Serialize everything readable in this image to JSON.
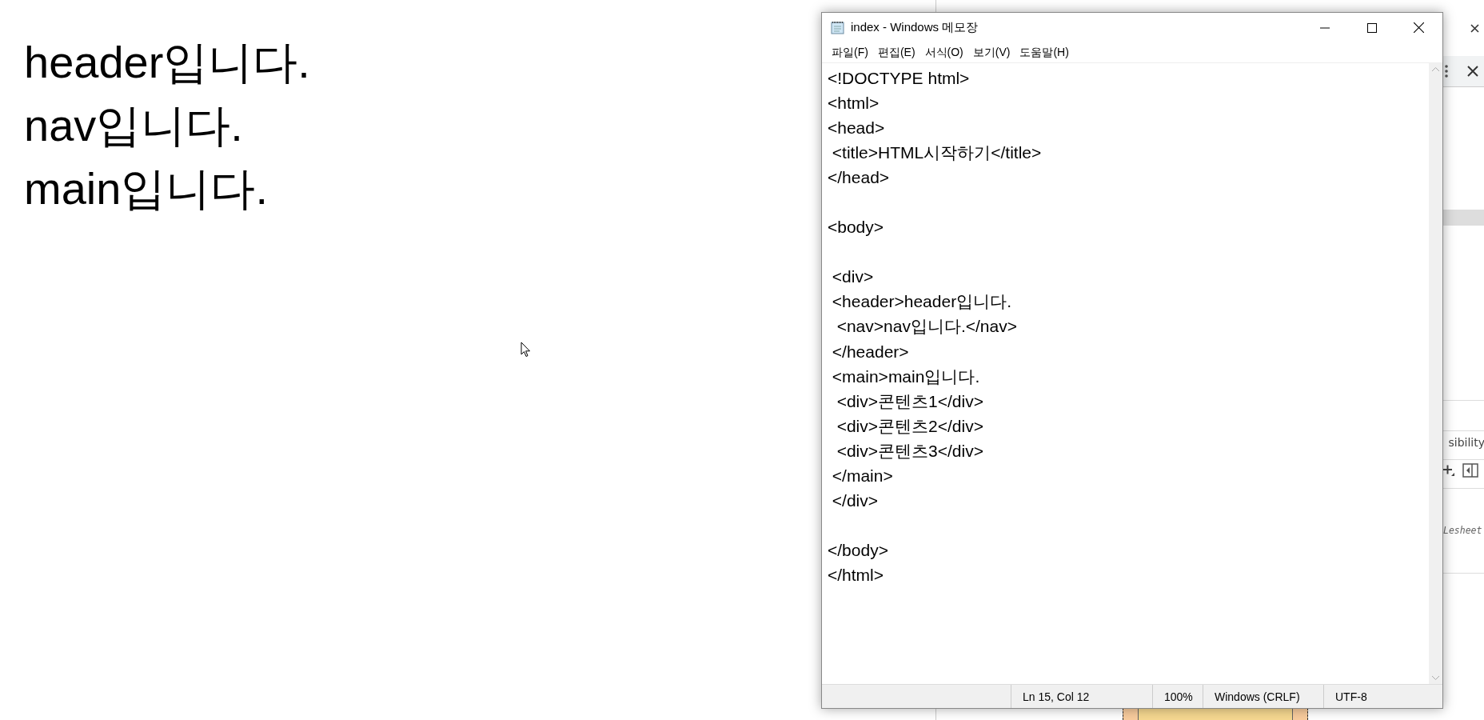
{
  "page": {
    "lines": [
      "header입니다.",
      "nav입니다.",
      "main입니다."
    ]
  },
  "devtools": {
    "tab_fragment": "sibility",
    "style_fragment": "Lesheet"
  },
  "notepad": {
    "title": "index - Windows 메모장",
    "menu": [
      "파일(F)",
      "편집(E)",
      "서식(O)",
      "보기(V)",
      "도움말(H)"
    ],
    "text": "<!DOCTYPE html>\n<html>\n<head>\n <title>HTML시작하기</title>\n</head>\n\n<body>\n\n <div>\n <header>header입니다.\n  <nav>nav입니다.</nav>\n </header>\n <main>main입니다.\n  <div>콘텐츠1</div>\n  <div>콘텐츠2</div>\n  <div>콘텐츠3</div>\n </main>\n </div>\n\n</body>\n</html>",
    "status": {
      "position": "Ln 15, Col 12",
      "zoom": "100%",
      "line_ending": "Windows (CRLF)",
      "encoding": "UTF-8"
    }
  }
}
